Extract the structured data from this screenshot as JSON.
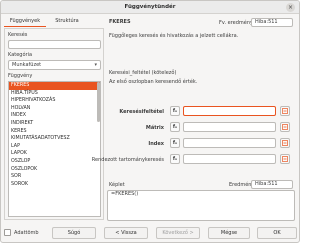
{
  "window": {
    "title": "Függvénytündér",
    "close_glyph": "×"
  },
  "tabs": [
    {
      "label": "Függvények"
    },
    {
      "label": "Struktúra"
    }
  ],
  "left": {
    "search_label": "Keresés",
    "search_value": "",
    "category_label": "Kategória",
    "category_value": "Munkafüzet",
    "function_label": "Függvény",
    "functions": [
      "FKERES",
      "HIBA.TÍPUS",
      "HIPERHIVATKOZÁS",
      "HOLVAN",
      "INDEX",
      "INDIREKT",
      "KERES",
      "KIMUTATÁSADATOTVESZ",
      "LAP",
      "LAPOK",
      "OSZLOP",
      "OSZLOPOK",
      "SOR",
      "SOROK"
    ],
    "selected_index": 0
  },
  "right": {
    "function_name": "FKERES",
    "result_label": "Fv. eredménye",
    "result_value": "Hiba:511",
    "description": "Függőleges keresés és hivatkozás a jelzett cellákra.",
    "param_name": "Keresési_feltétel (kötelező)",
    "param_desc": "Az első oszlopban keresendő érték.",
    "params": [
      {
        "label": "Keresésifeltétel",
        "bold": true,
        "value": "",
        "fx": "fₓ"
      },
      {
        "label": "Mátrix",
        "bold": true,
        "value": "",
        "fx": "fₓ"
      },
      {
        "label": "Index",
        "bold": true,
        "value": "",
        "fx": "fₓ"
      },
      {
        "label": "Rendezott tartománykeresés",
        "bold": false,
        "value": "",
        "fx": "fₓ"
      }
    ],
    "formula_label": "Képlet",
    "formula_result_label": "Eredmény",
    "formula_result_value": "Hiba:511",
    "formula_value": "=FKERES()"
  },
  "footer": {
    "array_label": "Adattömb",
    "help": "Súgó",
    "back": "< Vissza",
    "next": "Következő >",
    "cancel": "Mégse",
    "ok": "OK"
  },
  "colors": {
    "accent": "#e95420",
    "window_bg": "#f6f5f4",
    "field_bg": "#ffffff"
  }
}
